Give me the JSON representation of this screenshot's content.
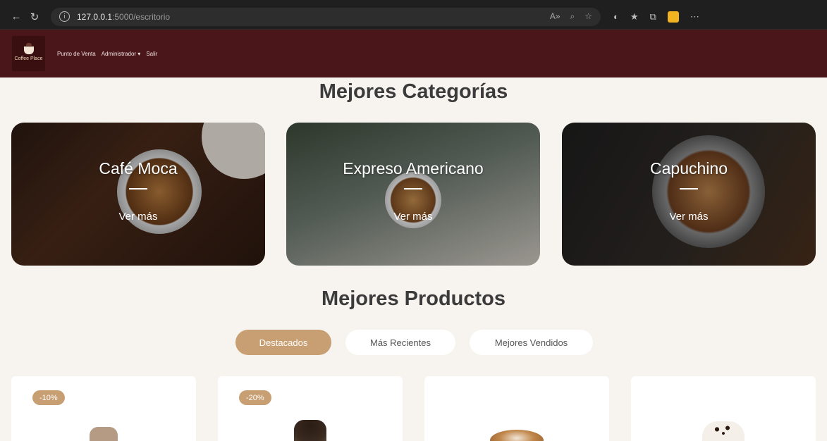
{
  "browser": {
    "url_host": "127.0.0.1",
    "url_path": ":5000/escritorio"
  },
  "navbar": {
    "logo_text": "Coffee Place",
    "links": [
      "Punto de Venta",
      "Administrador ▾",
      "Salir"
    ]
  },
  "categories": {
    "title": "Mejores Categorías",
    "items": [
      {
        "name": "Café Moca",
        "more": "Ver más"
      },
      {
        "name": "Expreso Americano",
        "more": "Ver más"
      },
      {
        "name": "Capuchino",
        "more": "Ver más"
      }
    ]
  },
  "products": {
    "title": "Mejores Productos",
    "filters": [
      "Destacados",
      "Más Recientes",
      "Mejores Vendidos"
    ],
    "active_filter": "Destacados",
    "badges": [
      "-10%",
      "-20%",
      "",
      ""
    ]
  },
  "colors": {
    "navbar": "#4a1619",
    "accent": "#c79f73",
    "background": "#f7f3ee"
  }
}
